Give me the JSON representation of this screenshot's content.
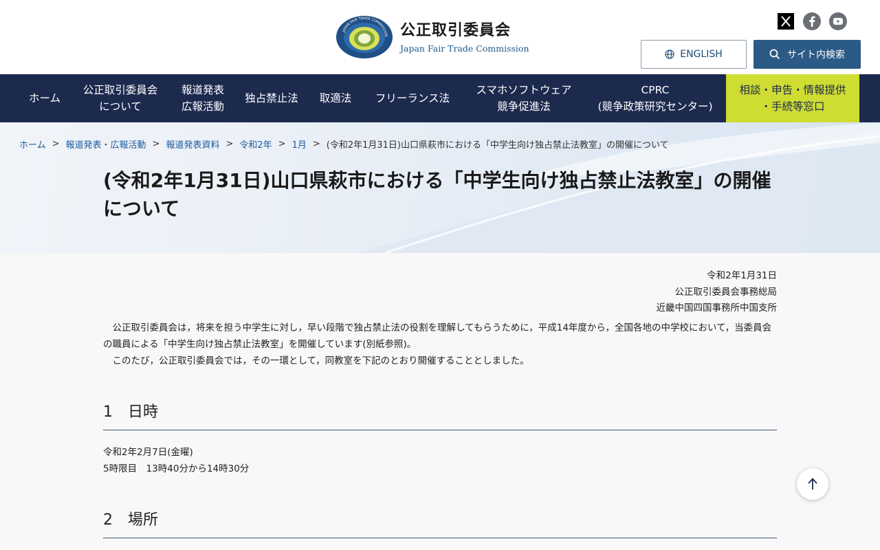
{
  "header": {
    "org_name_ja": "公正取引委員会",
    "org_name_en": "Japan Fair Trade Commission",
    "logo_ring_text": "JAPAN FAIR TRADE COMMISSION",
    "sns": [
      "x-icon",
      "facebook-icon",
      "youtube-icon"
    ],
    "english_label": "ENGLISH",
    "search_label": "サイト内検索"
  },
  "nav": {
    "items": [
      {
        "label": "ホーム",
        "width": 100
      },
      {
        "label": "公正取引委員会\nについて",
        "width": 148
      },
      {
        "label": "報道発表\n広報活動",
        "width": 92
      },
      {
        "label": "独占禁止法",
        "width": 110
      },
      {
        "label": "取適法",
        "width": 76
      },
      {
        "label": "フリーランス法",
        "width": 148
      },
      {
        "label": "スマホソフトウェア\n競争促進法",
        "width": 176
      },
      {
        "label": "CPRC\n(競争政策研究センター)",
        "width": 206
      }
    ],
    "consult_label": "相談・申告・情報提供\n・手続等窓口"
  },
  "breadcrumb": {
    "items": [
      "ホーム",
      "報道発表・広報活動",
      "報道発表資料",
      "令和2年",
      "1月"
    ],
    "current": "(令和2年1月31日)山口県萩市における「中学生向け独占禁止法教室」の開催について",
    "separator": ">"
  },
  "page": {
    "title": "(令和2年1月31日)山口県萩市における「中学生向け独占禁止法教室」の開催について",
    "date": "令和2年1月31日",
    "issuer1": "公正取引委員会事務総局",
    "issuer2": "近畿中国四国事務所中国支所",
    "para1": "公正取引委員会は，将来を担う中学生に対し，早い段階で独占禁止法の役割を理解してもらうために，平成14年度から，全国各地の中学校において，当委員会の職員による「中学生向け独占禁止法教室」を開催しています(別紙参照)。",
    "para2": "このたび，公正取引委員会では，その一環として，同教室を下記のとおり開催することとしました。",
    "section1": {
      "heading": "1　日時",
      "line1": "令和2年2月7日(金曜)",
      "line2": "5時限目　13時40分から14時30分"
    },
    "section2": {
      "heading": "2　場所"
    }
  },
  "colors": {
    "nav_bg": "#1c2a4e",
    "consult_bg": "#cfdc32",
    "search_bg": "#2c5a86",
    "link": "#1c5a9e"
  }
}
